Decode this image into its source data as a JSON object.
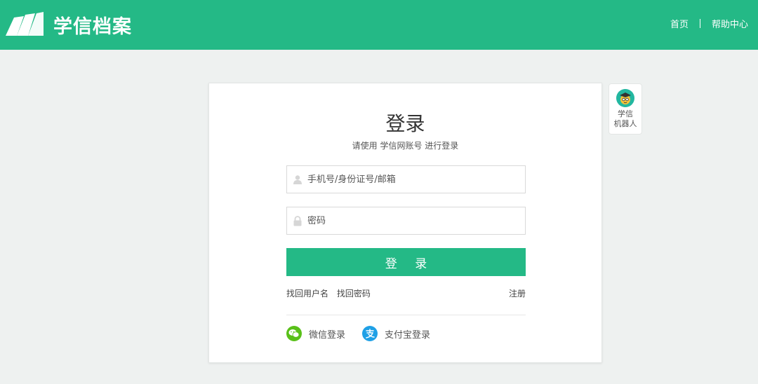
{
  "header": {
    "brand": "学信档案",
    "nav": {
      "home": "首页",
      "help": "帮助中心"
    }
  },
  "login": {
    "title": "登录",
    "subtitle": "请使用 学信网账号 进行登录",
    "username_placeholder": "手机号/身份证号/邮箱",
    "password_placeholder": "密码",
    "submit_label": "登 录",
    "links": {
      "find_username": "找回用户名",
      "find_password": "找回密码",
      "register": "注册"
    },
    "social": {
      "wechat": "微信登录",
      "alipay": "支付宝登录"
    }
  },
  "robot": {
    "line1": "学信",
    "line2": "机器人"
  },
  "colors": {
    "brand_green": "#24b986",
    "wechat_green": "#59c019",
    "alipay_blue": "#1fa0e6"
  },
  "icons": [
    "book-logo-icon",
    "user-icon",
    "lock-icon",
    "wechat-icon",
    "alipay-icon",
    "robot-avatar-icon"
  ]
}
